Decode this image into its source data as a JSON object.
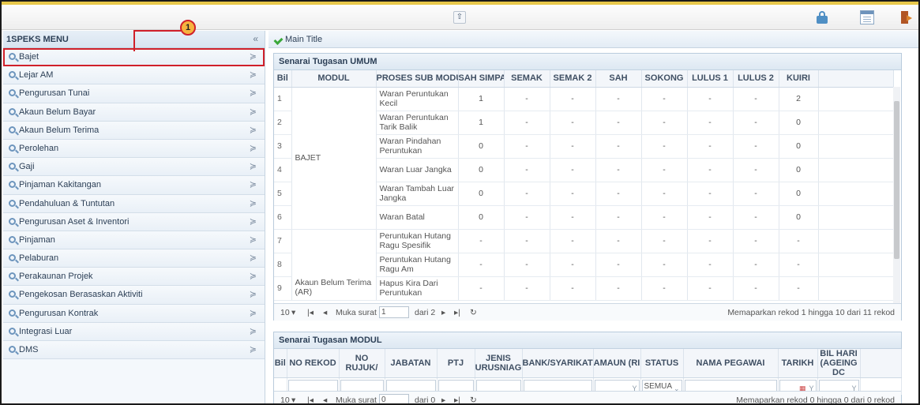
{
  "topbar": {
    "collapse_glyph": "≈",
    "icons": [
      "lock-icon",
      "calendar-icon",
      "exit-icon"
    ]
  },
  "sidebar": {
    "title": "1SPEKS MENU",
    "collapse_glyph": "«",
    "items": [
      {
        "label": "Bajet"
      },
      {
        "label": "Lejar AM"
      },
      {
        "label": "Pengurusan Tunai"
      },
      {
        "label": "Akaun Belum Bayar"
      },
      {
        "label": "Akaun Belum Terima"
      },
      {
        "label": "Perolehan"
      },
      {
        "label": "Gaji"
      },
      {
        "label": "Pinjaman Kakitangan"
      },
      {
        "label": "Pendahuluan & Tuntutan"
      },
      {
        "label": "Pengurusan Aset & Inventori"
      },
      {
        "label": "Pinjaman"
      },
      {
        "label": "Pelaburan"
      },
      {
        "label": "Perakaunan Projek"
      },
      {
        "label": "Pengekosan Berasaskan Aktiviti"
      },
      {
        "label": "Pengurusan Kontrak"
      },
      {
        "label": "Integrasi Luar"
      },
      {
        "label": "DMS"
      }
    ],
    "chevron": "≽"
  },
  "callout": {
    "number": "1"
  },
  "main": {
    "title": "Main Title",
    "umum": {
      "header": "Senarai Tugasan UMUM",
      "columns": [
        "Bil",
        "MODUL",
        "PROSES SUB MODU",
        "SAH SIMPAN",
        "SEMAK",
        "SEMAK 2",
        "SAH",
        "SOKONG",
        "LULUS 1",
        "LULUS 2",
        "KUIRI"
      ],
      "rows": [
        {
          "bil": "1",
          "proses": "Waran Peruntukan Kecil",
          "sah_simpan": "1",
          "semak": "-",
          "semak2": "-",
          "sah": "-",
          "sokong": "-",
          "lulus1": "-",
          "lulus2": "-",
          "kuiri": "2"
        },
        {
          "bil": "2",
          "proses": "Waran Peruntukan Tarik Balik",
          "sah_simpan": "1",
          "semak": "-",
          "semak2": "-",
          "sah": "-",
          "sokong": "-",
          "lulus1": "-",
          "lulus2": "-",
          "kuiri": "0"
        },
        {
          "bil": "3",
          "proses": "Waran Pindahan Peruntukan",
          "sah_simpan": "0",
          "semak": "-",
          "semak2": "-",
          "sah": "-",
          "sokong": "-",
          "lulus1": "-",
          "lulus2": "-",
          "kuiri": "0"
        },
        {
          "bil": "4",
          "proses": "Waran Luar Jangka",
          "sah_simpan": "0",
          "semak": "-",
          "semak2": "-",
          "sah": "-",
          "sokong": "-",
          "lulus1": "-",
          "lulus2": "-",
          "kuiri": "0"
        },
        {
          "bil": "5",
          "proses": "Waran Tambah Luar Jangka",
          "sah_simpan": "0",
          "semak": "-",
          "semak2": "-",
          "sah": "-",
          "sokong": "-",
          "lulus1": "-",
          "lulus2": "-",
          "kuiri": "0"
        },
        {
          "bil": "6",
          "proses": "Waran Batal",
          "sah_simpan": "0",
          "semak": "-",
          "semak2": "-",
          "sah": "-",
          "sokong": "-",
          "lulus1": "-",
          "lulus2": "-",
          "kuiri": "0"
        },
        {
          "bil": "7",
          "proses": "Peruntukan Hutang Ragu Spesifik",
          "sah_simpan": "-",
          "semak": "-",
          "semak2": "-",
          "sah": "-",
          "sokong": "-",
          "lulus1": "-",
          "lulus2": "-",
          "kuiri": "-"
        },
        {
          "bil": "8",
          "proses": "Peruntukan Hutang Ragu Am",
          "sah_simpan": "-",
          "semak": "-",
          "semak2": "-",
          "sah": "-",
          "sokong": "-",
          "lulus1": "-",
          "lulus2": "-",
          "kuiri": "-"
        },
        {
          "bil": "9",
          "proses": "Hapus Kira Dari Peruntukan",
          "sah_simpan": "-",
          "semak": "-",
          "semak2": "-",
          "sah": "-",
          "sokong": "-",
          "lulus1": "-",
          "lulus2": "-",
          "kuiri": "-"
        }
      ],
      "modul_bajet": "BAJET",
      "modul_ar": "Akaun Belum Terima (AR)",
      "pager": {
        "page_size": "10",
        "muka_surat_label": "Muka surat",
        "page": "1",
        "dari_label": "dari 2",
        "status": "Memaparkan rekod 1 hingga 10 dari 11 rekod"
      }
    },
    "modul": {
      "header": "Senarai Tugasan MODUL",
      "columns": [
        "Bil",
        "NO REKOD",
        "NO RUJUK/",
        "JABATAN",
        "PTJ",
        "JENIS URUSNIAG",
        "BANK/SYARIKAT",
        "AMAUN (RI",
        "STATUS",
        "NAMA PEGAWAI",
        "TARIKH",
        "BIL HARI (AGEING DC"
      ],
      "status_filter": "SEMUA",
      "pager": {
        "page_size": "10",
        "muka_surat_label": "Muka surat",
        "page": "0",
        "dari_label": "dari 0",
        "status": "Memaparkan rekod 0 hingga 0 dari 0 rekod"
      }
    }
  }
}
